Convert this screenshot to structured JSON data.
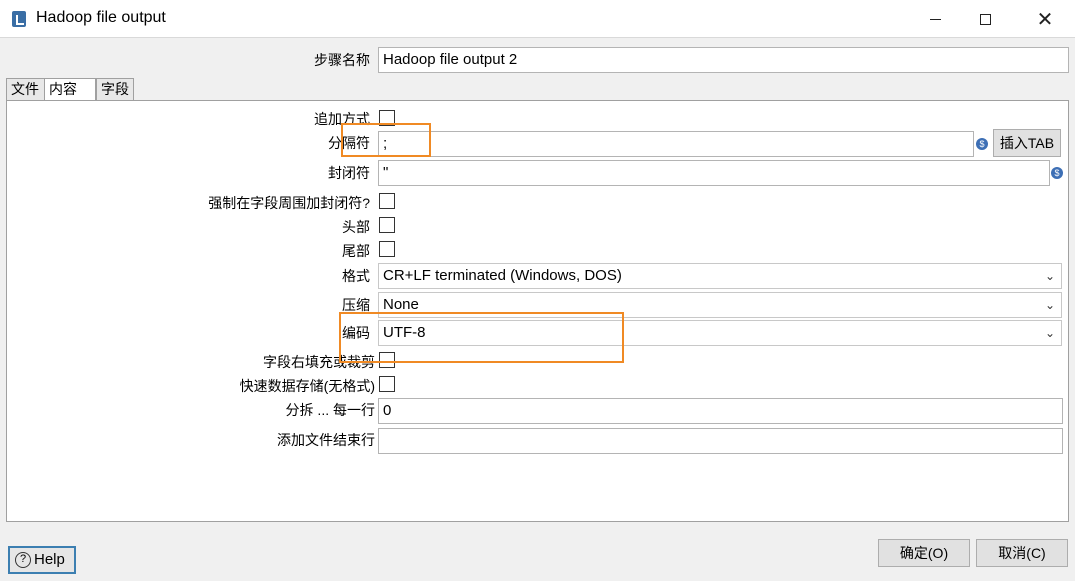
{
  "window": {
    "title": "Hadoop file output"
  },
  "controls": {
    "minimize": "",
    "maximize": "",
    "close": "✕"
  },
  "step_name": {
    "label": "步骤名称",
    "value": "Hadoop file output 2"
  },
  "tabs": [
    {
      "label": "文件"
    },
    {
      "label": "内容"
    },
    {
      "label": "字段"
    }
  ],
  "content": {
    "append": {
      "label": "追加方式",
      "checked": false
    },
    "separator": {
      "label": "分隔符",
      "value": ";",
      "insert_tab": "插入TAB"
    },
    "enclosure": {
      "label": "封闭符",
      "value": "\""
    },
    "force_enclosure": {
      "label": "强制在字段周围加封闭符?",
      "checked": false
    },
    "header": {
      "label": "头部",
      "checked": false
    },
    "footer": {
      "label": "尾部",
      "checked": false
    },
    "format": {
      "label": "格式",
      "value": "CR+LF terminated (Windows, DOS)"
    },
    "compression": {
      "label": "压缩",
      "value": "None"
    },
    "encoding": {
      "label": "编码",
      "value": "UTF-8"
    },
    "pad_fields": {
      "label": "字段右填充或裁剪",
      "checked": false
    },
    "fast_dump": {
      "label": "快速数据存储(无格式)",
      "checked": false
    },
    "split_every": {
      "label": "分拆 ... 每一行",
      "value": "0"
    },
    "end_line": {
      "label": "添加文件结束行",
      "value": ""
    }
  },
  "buttons": {
    "help": "Help",
    "ok": "确定(O)",
    "cancel": "取消(C)"
  },
  "colors": {
    "highlight": "#f08a24",
    "help_border": "#3c7fb1"
  }
}
